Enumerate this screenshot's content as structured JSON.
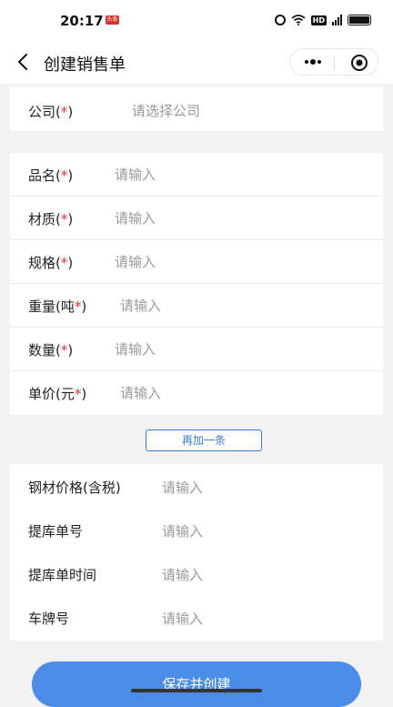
{
  "status_bar": {
    "time": "20:17",
    "badge": "头条"
  },
  "nav": {
    "title": "创建销售单"
  },
  "company": {
    "label": "公司(",
    "req": "*",
    "suffix": ")",
    "placeholder": "请选择公司"
  },
  "product_rows": [
    {
      "label": "品名(",
      "req": "*",
      "suffix": ")",
      "placeholder": "请输入"
    },
    {
      "label": "材质(",
      "req": "*",
      "suffix": ")",
      "placeholder": "请输入"
    },
    {
      "label": "规格(",
      "req": "*",
      "suffix": ")",
      "placeholder": "请输入"
    },
    {
      "label": "重量(吨",
      "req": "*",
      "suffix": ")",
      "placeholder": "请输入"
    },
    {
      "label": "数量(",
      "req": "*",
      "suffix": ")",
      "placeholder": "请输入"
    },
    {
      "label": "单价(元",
      "req": "*",
      "suffix": ")",
      "placeholder": "请输入"
    }
  ],
  "add_more_label": "再加一条",
  "extra_rows": [
    {
      "label": "钢材价格(含税)",
      "placeholder": "请输入"
    },
    {
      "label": "提库单号",
      "placeholder": "请输入"
    },
    {
      "label": "提库单时间",
      "placeholder": "请输入"
    },
    {
      "label": "车牌号",
      "placeholder": "请输入"
    }
  ],
  "save_label": "保存并创建"
}
